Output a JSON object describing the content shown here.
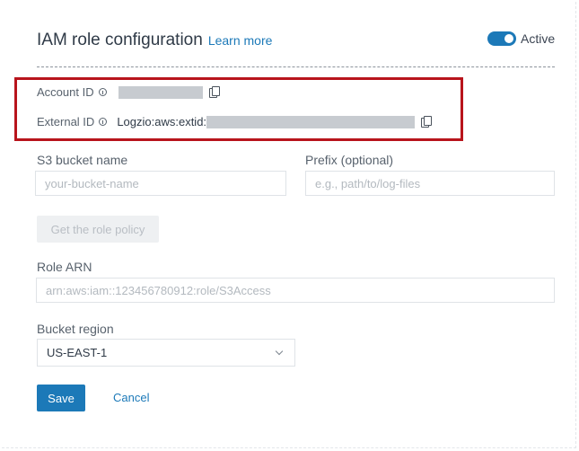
{
  "header": {
    "title": "IAM role configuration",
    "learn_more": "Learn more",
    "active_label": "Active",
    "active_on": true
  },
  "credentials": {
    "account_id": {
      "label": "Account ID",
      "info_icon": "info-icon",
      "copy_icon": "copy-icon"
    },
    "external_id": {
      "label": "External ID",
      "prefix": "Logzio:aws:extid:",
      "info_icon": "info-icon",
      "copy_icon": "copy-icon"
    }
  },
  "form": {
    "s3_bucket": {
      "label": "S3 bucket name",
      "placeholder": "your-bucket-name",
      "value": ""
    },
    "prefix": {
      "label": "Prefix (optional)",
      "placeholder": "e.g., path/to/log-files",
      "value": ""
    },
    "get_policy_button": "Get the role policy",
    "role_arn": {
      "label": "Role ARN",
      "placeholder": "arn:aws:iam::123456780912:role/S3Access",
      "value": ""
    },
    "bucket_region": {
      "label": "Bucket region",
      "selected": "US-EAST-1"
    }
  },
  "actions": {
    "save": "Save",
    "cancel": "Cancel"
  },
  "colors": {
    "accent": "#1c79b8",
    "highlight_border": "#b8141c",
    "masked_value": "#c7cbd0"
  }
}
